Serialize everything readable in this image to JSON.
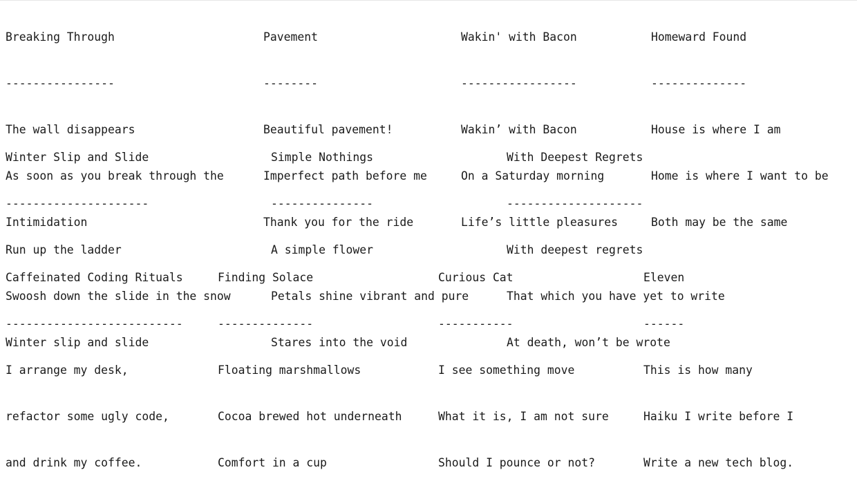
{
  "sections": [
    {
      "haikus": [
        {
          "title": "Breaking Through",
          "underline": "----------------",
          "lines": [
            "The wall disappears",
            "As soon as you break through the",
            "Intimidation"
          ]
        },
        {
          "title": "Pavement",
          "underline": "--------",
          "lines": [
            "Beautiful pavement!",
            "Imperfect path before me",
            "Thank you for the ride"
          ]
        },
        {
          "title": "Wakin' with Bacon",
          "underline": "-----------------",
          "lines": [
            "Wakin’ with Bacon",
            "On a Saturday morning",
            "Life’s little pleasures"
          ]
        },
        {
          "title": "Homeward Found",
          "underline": "--------------",
          "lines": [
            "House is where I am",
            "Home is where I want to be",
            "Both may be the same"
          ]
        }
      ]
    },
    {
      "haikus": [
        {
          "title": "Winter Slip and Slide",
          "underline": "---------------------",
          "lines": [
            "Run up the ladder",
            "Swoosh down the slide in the snow",
            "Winter slip and slide"
          ]
        },
        {
          "title": "Simple Nothings",
          "underline": "---------------",
          "lines": [
            "A simple flower",
            "Petals shine vibrant and pure",
            "Stares into the void"
          ]
        },
        {
          "title": "With Deepest Regrets",
          "underline": "--------------------",
          "lines": [
            "With deepest regrets",
            "That which you have yet to write",
            "At death, won’t be wrote"
          ]
        }
      ]
    },
    {
      "haikus": [
        {
          "title": "Caffeinated Coding Rituals",
          "underline": "--------------------------",
          "lines": [
            "I arrange my desk,",
            "refactor some ugly code,",
            "and drink my coffee."
          ]
        },
        {
          "title": "Finding Solace",
          "underline": "--------------",
          "lines": [
            "Floating marshmallows",
            "Cocoa brewed hot underneath",
            "Comfort in a cup"
          ]
        },
        {
          "title": "Curious Cat",
          "underline": "-----------",
          "lines": [
            "I see something move",
            "What it is, I am not sure",
            "Should I pounce or not?"
          ]
        },
        {
          "title": "Eleven",
          "underline": "------",
          "lines": [
            "This is how many",
            "Haiku I write before I",
            "Write a new tech blog."
          ]
        }
      ]
    }
  ]
}
